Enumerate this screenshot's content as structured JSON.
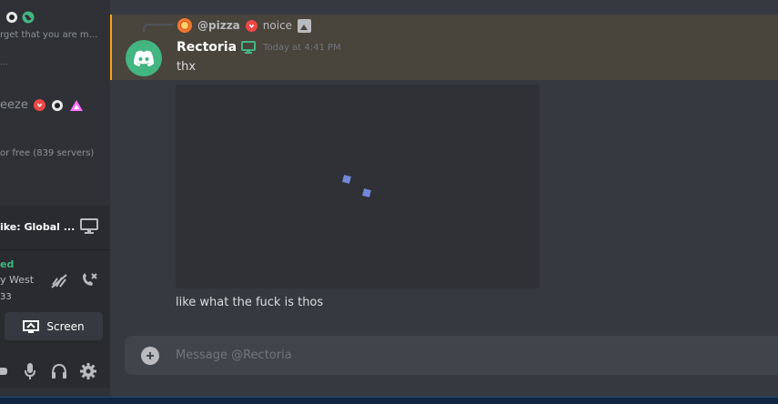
{
  "sidebar": {
    "dm_preview_1": "rget that you are m...",
    "dm_name_2": "eeze",
    "dm_preview_2": "or free (839 servers)",
    "small_mark": "...",
    "activity_title": "ike: Global ...",
    "voice_status": "ed",
    "voice_region": "y West",
    "voice_ping": "33",
    "screen_button_label": "Screen"
  },
  "message": {
    "reply": {
      "username": "@pizza",
      "text": "noice"
    },
    "author": "Rectoria",
    "timestamp": "Today at 4:41 PM",
    "text_1": "thx",
    "text_2": "like what the fuck is thos"
  },
  "composer": {
    "placeholder": "Message @Rectoria"
  },
  "colors": {
    "accent": "#7289da",
    "online_green": "#43b581",
    "mention_highlight": "#49443c",
    "mention_border": "#faa61a",
    "danger_red": "#f04747"
  },
  "icons": [
    "compass-icon",
    "globe-icon",
    "heart-badge-icon",
    "triangle-icon",
    "screenshare-icon",
    "noise-suppression-icon",
    "disconnect-icon",
    "screen-icon",
    "gamepad-icon",
    "mic-icon",
    "headphones-icon",
    "gear-icon",
    "plus-icon",
    "discord-logo-icon",
    "desktop-icon",
    "image-icon"
  ]
}
